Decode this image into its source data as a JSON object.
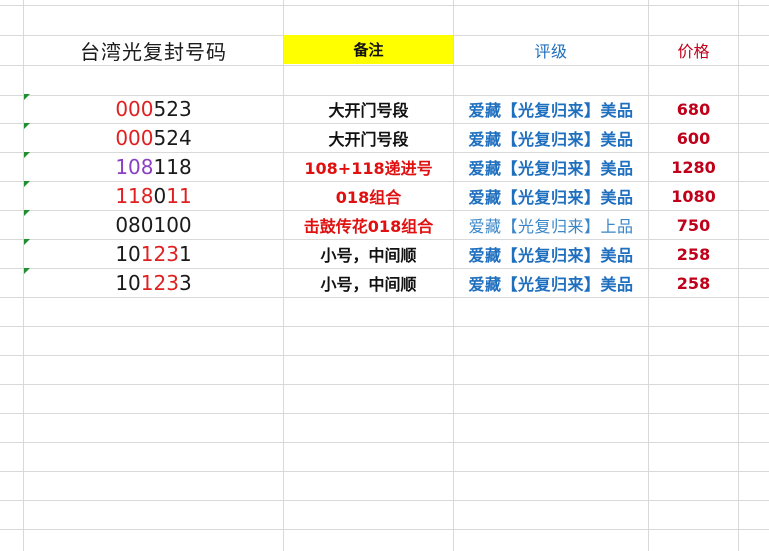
{
  "header": {
    "title": "台湾光复封号码",
    "note": "备注",
    "grade": "评级",
    "price": "价格"
  },
  "rows": [
    {
      "code_parts": [
        {
          "text": "000",
          "color": "red"
        },
        {
          "text": "523",
          "color": "black"
        }
      ],
      "note": "大开门号段",
      "note_style": "black",
      "grade": "爱藏【光复归来】美品",
      "grade_style": "bold",
      "price": "680"
    },
    {
      "code_parts": [
        {
          "text": "000",
          "color": "red"
        },
        {
          "text": "524",
          "color": "black"
        }
      ],
      "note": "大开门号段",
      "note_style": "black",
      "grade": "爱藏【光复归来】美品",
      "grade_style": "bold",
      "price": "600"
    },
    {
      "code_parts": [
        {
          "text": "108",
          "color": "purple"
        },
        {
          "text": "118",
          "color": "black"
        }
      ],
      "note": "108+118递进号",
      "note_style": "red",
      "grade": "爱藏【光复归来】美品",
      "grade_style": "bold",
      "price": "1280"
    },
    {
      "code_parts": [
        {
          "text": "1",
          "color": "red"
        },
        {
          "text": "18",
          "color": "red"
        },
        {
          "text": "0",
          "color": "black"
        },
        {
          "text": "11",
          "color": "red"
        }
      ],
      "note": "018组合",
      "note_style": "red",
      "grade": "爱藏【光复归来】美品",
      "grade_style": "bold",
      "price": "1080"
    },
    {
      "code_parts": [
        {
          "text": "080100",
          "color": "black"
        }
      ],
      "note": "击鼓传花018组合",
      "note_style": "red",
      "grade": "爱藏【光复归来】上品",
      "grade_style": "plain",
      "price": "750"
    },
    {
      "code_parts": [
        {
          "text": "10",
          "color": "black"
        },
        {
          "text": "123",
          "color": "red"
        },
        {
          "text": "1",
          "color": "black"
        }
      ],
      "note": "小号，中间顺",
      "note_style": "black",
      "grade": "爱藏【光复归来】美品",
      "grade_style": "bold",
      "price": "258"
    },
    {
      "code_parts": [
        {
          "text": "10",
          "color": "black"
        },
        {
          "text": "123",
          "color": "red"
        },
        {
          "text": "3",
          "color": "black"
        }
      ],
      "note": "小号，中间顺",
      "note_style": "black",
      "grade": "爱藏【光复归来】美品",
      "grade_style": "bold",
      "price": "258"
    }
  ],
  "colors": {
    "red": "#e02020",
    "purple": "#8a3fc4",
    "black": "#1a1a1a",
    "note_red": "#e01010",
    "grade_blue": "#1f6fbf",
    "price_red": "#c0001a",
    "header_fill": "#ffff00",
    "comment_marker": "#1f8f2f"
  }
}
